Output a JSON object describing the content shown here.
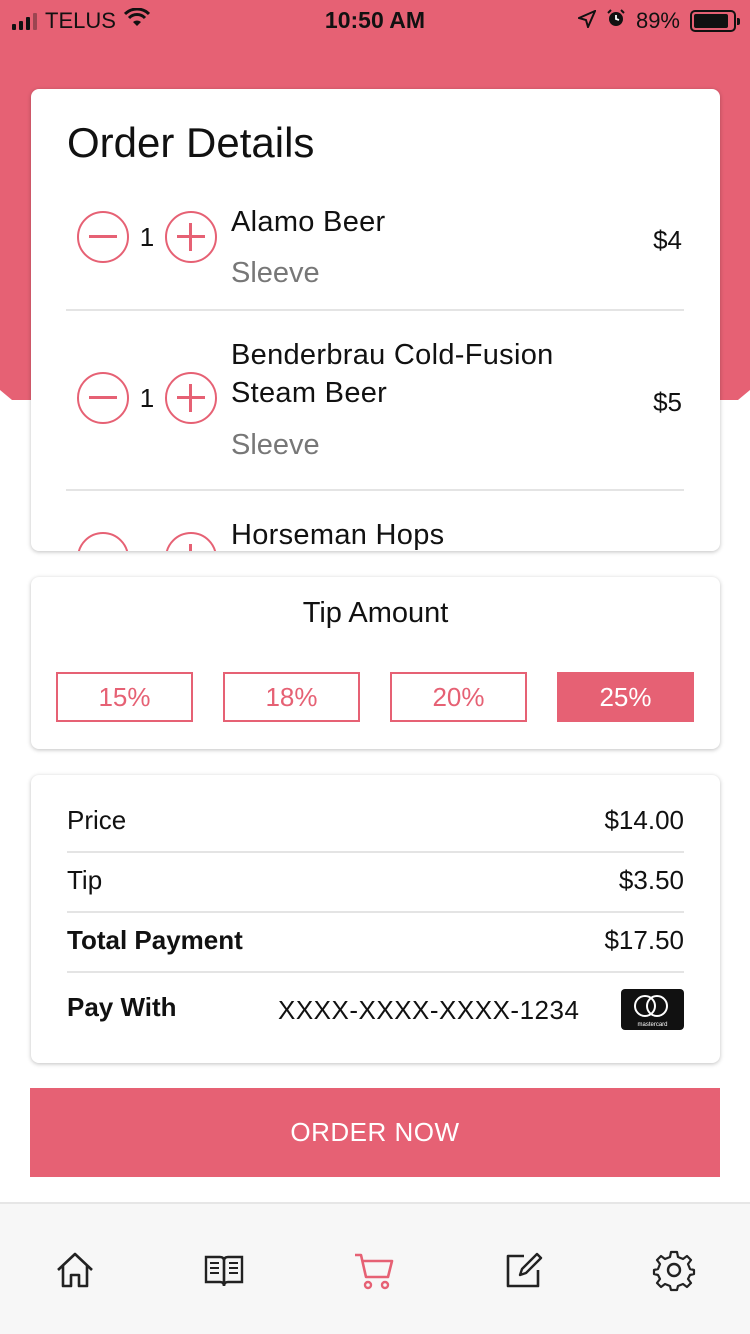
{
  "status_bar": {
    "carrier": "TELUS",
    "time": "10:50 AM",
    "battery": "89%"
  },
  "order": {
    "title": "Order Details",
    "items": [
      {
        "qty": "1",
        "name_line1": "Alamo Beer",
        "name_line2": "",
        "variant": "Sleeve",
        "price": "$4"
      },
      {
        "qty": "1",
        "name_line1": "Benderbrau Cold-Fusion",
        "name_line2": "Steam Beer",
        "variant": "Sleeve",
        "price": "$5"
      },
      {
        "qty": "",
        "name_line1": "Horseman Hops",
        "name_line2": "",
        "variant": "",
        "price": ""
      }
    ]
  },
  "tip": {
    "title": "Tip Amount",
    "options": [
      "15%",
      "18%",
      "20%",
      "25%"
    ],
    "selected": "25%"
  },
  "summary": {
    "price_label": "Price",
    "price_value": "$14.00",
    "tip_label": "Tip",
    "tip_value": "$3.50",
    "total_label": "Total Payment",
    "total_value": "$17.50",
    "pay_label": "Pay With",
    "card_number": "XXXX-XXXX-XXXX-1234",
    "card_brand": "mastercard"
  },
  "order_button": "ORDER NOW",
  "tabs": [
    {
      "icon": "home-icon",
      "active": false
    },
    {
      "icon": "menu-book-icon",
      "active": false
    },
    {
      "icon": "cart-icon",
      "active": true
    },
    {
      "icon": "edit-icon",
      "active": false
    },
    {
      "icon": "settings-icon",
      "active": false
    }
  ],
  "colors": {
    "accent": "#e66174",
    "inactive_icon": "#222222",
    "text": "#111111",
    "muted_text": "#777777"
  }
}
